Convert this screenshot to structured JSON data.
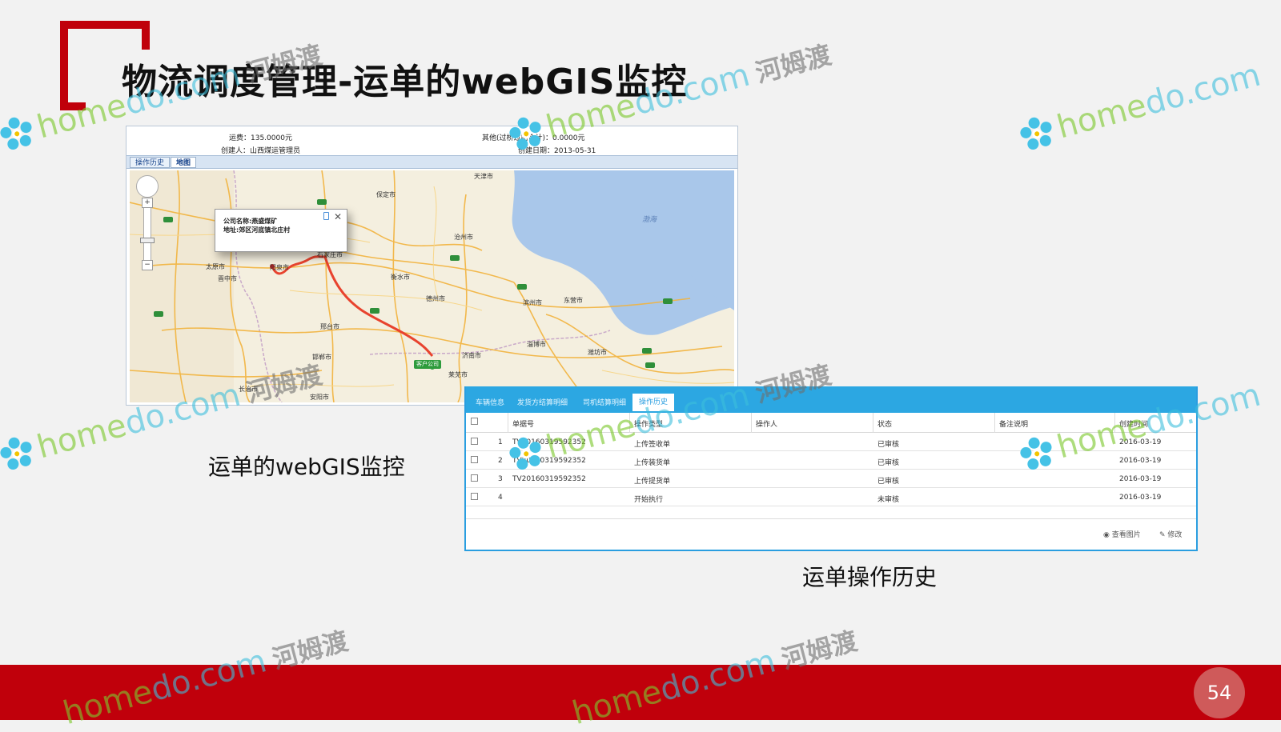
{
  "slide": {
    "title": "物流调度管理-运单的webGIS监控",
    "page_number": "54",
    "accent_color": "#c0000b",
    "background_color": "#f2f2f2"
  },
  "captions": {
    "map": "运单的webGIS监控",
    "history": "运单操作历史"
  },
  "map_panel": {
    "freight": "运费：135.0000元",
    "other_fees": "其他(过桥过路合计)：0.0000元",
    "creator": "创建人：山西煤运管理员",
    "created_date": "创建日期：2013-05-31",
    "tabs": [
      "操作历史",
      "地图"
    ],
    "active_tab": "地图",
    "popup": {
      "line1": "公司名称:燕盛煤矿",
      "line2": "地址:郊区河底镇北庄村"
    },
    "destination_label": "客户公司",
    "sea_label": "渤海",
    "cities": [
      "天津市",
      "保定市",
      "沧州市",
      "石家庄市",
      "太原市",
      "衡水市",
      "德州市",
      "滨州市",
      "东营市",
      "邢台市",
      "济南市",
      "淄博市",
      "潍坊市",
      "长治市",
      "邯郸市",
      "安阳市",
      "晋中市",
      "阳泉市",
      "莱芜市"
    ],
    "route_color": "#e8432e"
  },
  "history_grid": {
    "tabs": [
      "车辆信息",
      "发货方结算明细",
      "司机结算明细",
      "操作历史"
    ],
    "active_tab": "操作历史",
    "tab_bar_color": "#2ca7e2",
    "columns": [
      "单据号",
      "操作类型",
      "操作人",
      "状态",
      "备注说明",
      "创建时间"
    ],
    "rows": [
      {
        "index": "1",
        "doc_no": "TV20160319592352",
        "op_type": "上传签收单",
        "operator": "",
        "status": "已审核",
        "remark": "",
        "created": "2016-03-19"
      },
      {
        "index": "2",
        "doc_no": "TV20160319592352",
        "op_type": "上传装货单",
        "operator": "",
        "status": "已审核",
        "remark": "",
        "created": "2016-03-19"
      },
      {
        "index": "3",
        "doc_no": "TV20160319592352",
        "op_type": "上传提货单",
        "operator": "",
        "status": "已审核",
        "remark": "",
        "created": "2016-03-19"
      },
      {
        "index": "4",
        "doc_no": "",
        "op_type": "开始执行",
        "operator": "",
        "status": "未审核",
        "remark": "",
        "created": "2016-03-19"
      }
    ],
    "footer_buttons": [
      "查看图片",
      "修改"
    ]
  },
  "watermark": {
    "brand_a": "home",
    "brand_b": "do.com",
    "chinese": "河姆渡"
  }
}
